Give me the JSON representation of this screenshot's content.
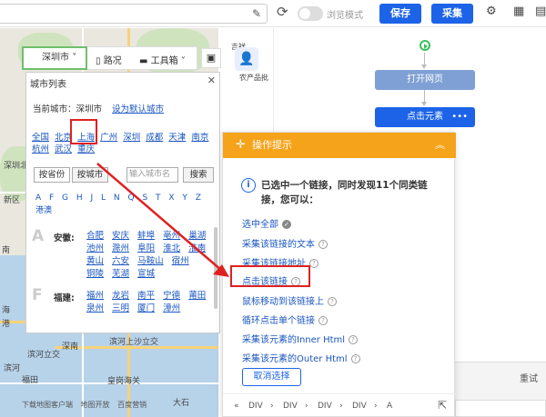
{
  "toolbar": {
    "browse_mode": "浏览模式",
    "save_label": "保存",
    "collect_label": "采集",
    "icons": [
      "edit-icon",
      "refresh-icon",
      "gear-icon",
      "grid-icon",
      "table-icon"
    ]
  },
  "map": {
    "city_selector": "深圳市",
    "roads_label": "路况",
    "toolbox_label": "工具箱",
    "labels": {
      "agri": "农产品批",
      "jixiang": "吉祥",
      "shenzhen_north": "深圳北",
      "new_area": "新区",
      "sea_view": "南",
      "coast": "海",
      "anchor": "港",
      "binhe": "滨河",
      "binhe_bay": "滨河上沙立交",
      "xiangmihu": "香蜜湖",
      "futian": "福田",
      "huanggang": "皇岗海关",
      "dashi": "大石",
      "binhe_interchange": "滨河立交",
      "nanyuan": "南园",
      "shennan": "深南"
    },
    "footer": [
      "下载地图客户端",
      "地图开放",
      "百度营销"
    ]
  },
  "city_panel": {
    "title": "城市列表",
    "current_label": "当前城市：深圳市",
    "set_default": "设为默认城市",
    "hot_cities": [
      "全国",
      "北京",
      "上海",
      "广州",
      "深圳",
      "成都",
      "天津",
      "南京",
      "杭州",
      "武汉",
      "重庆"
    ],
    "tab_province": "按省份",
    "tab_city": "按城市",
    "input_placeholder": "输入城市名",
    "search_label": "搜索",
    "letters": "A F G H J L N Q S T X Y Z",
    "letters_2": "港澳",
    "provinces": [
      {
        "letter": "A",
        "name": "安徽:",
        "cities": [
          "合肥",
          "安庆",
          "蚌埠",
          "亳州",
          "巢湖",
          "池州",
          "滁州",
          "阜阳",
          "淮北",
          "淮南",
          "黄山",
          "六安",
          "马鞍山",
          "宿州",
          "铜陵",
          "芜湖",
          "宣城"
        ]
      },
      {
        "letter": "F",
        "name": "福建:",
        "cities": [
          "福州",
          "龙岩",
          "南平",
          "宁德",
          "莆田",
          "泉州",
          "三明",
          "厦门",
          "漳州"
        ]
      }
    ]
  },
  "workflow": {
    "node_open": "打开网页",
    "node_click": "点击元素",
    "node_more": "•••"
  },
  "tips": {
    "title": "操作提示",
    "description": "已选中一个链接，同时发现11个同类链接，您可以：",
    "options": [
      "选中全部",
      "采集该链接的文本",
      "采集该链接地址",
      "点击该链接",
      "鼠标移动到该链接上",
      "循环点击单个链接",
      "采集该元素的Inner Html",
      "采集该元素的Outer Html"
    ],
    "cancel_label": "取消选择",
    "breadcrumb": [
      "DIV",
      "DIV",
      "DIV",
      "DIV",
      "A"
    ]
  },
  "bottom": {
    "retry_label": "重试"
  },
  "colors": {
    "primary_blue": "#1c63e8",
    "tips_orange": "#f5a31a",
    "highlight_red": "#e02020",
    "start_green": "#3cbf5c"
  }
}
